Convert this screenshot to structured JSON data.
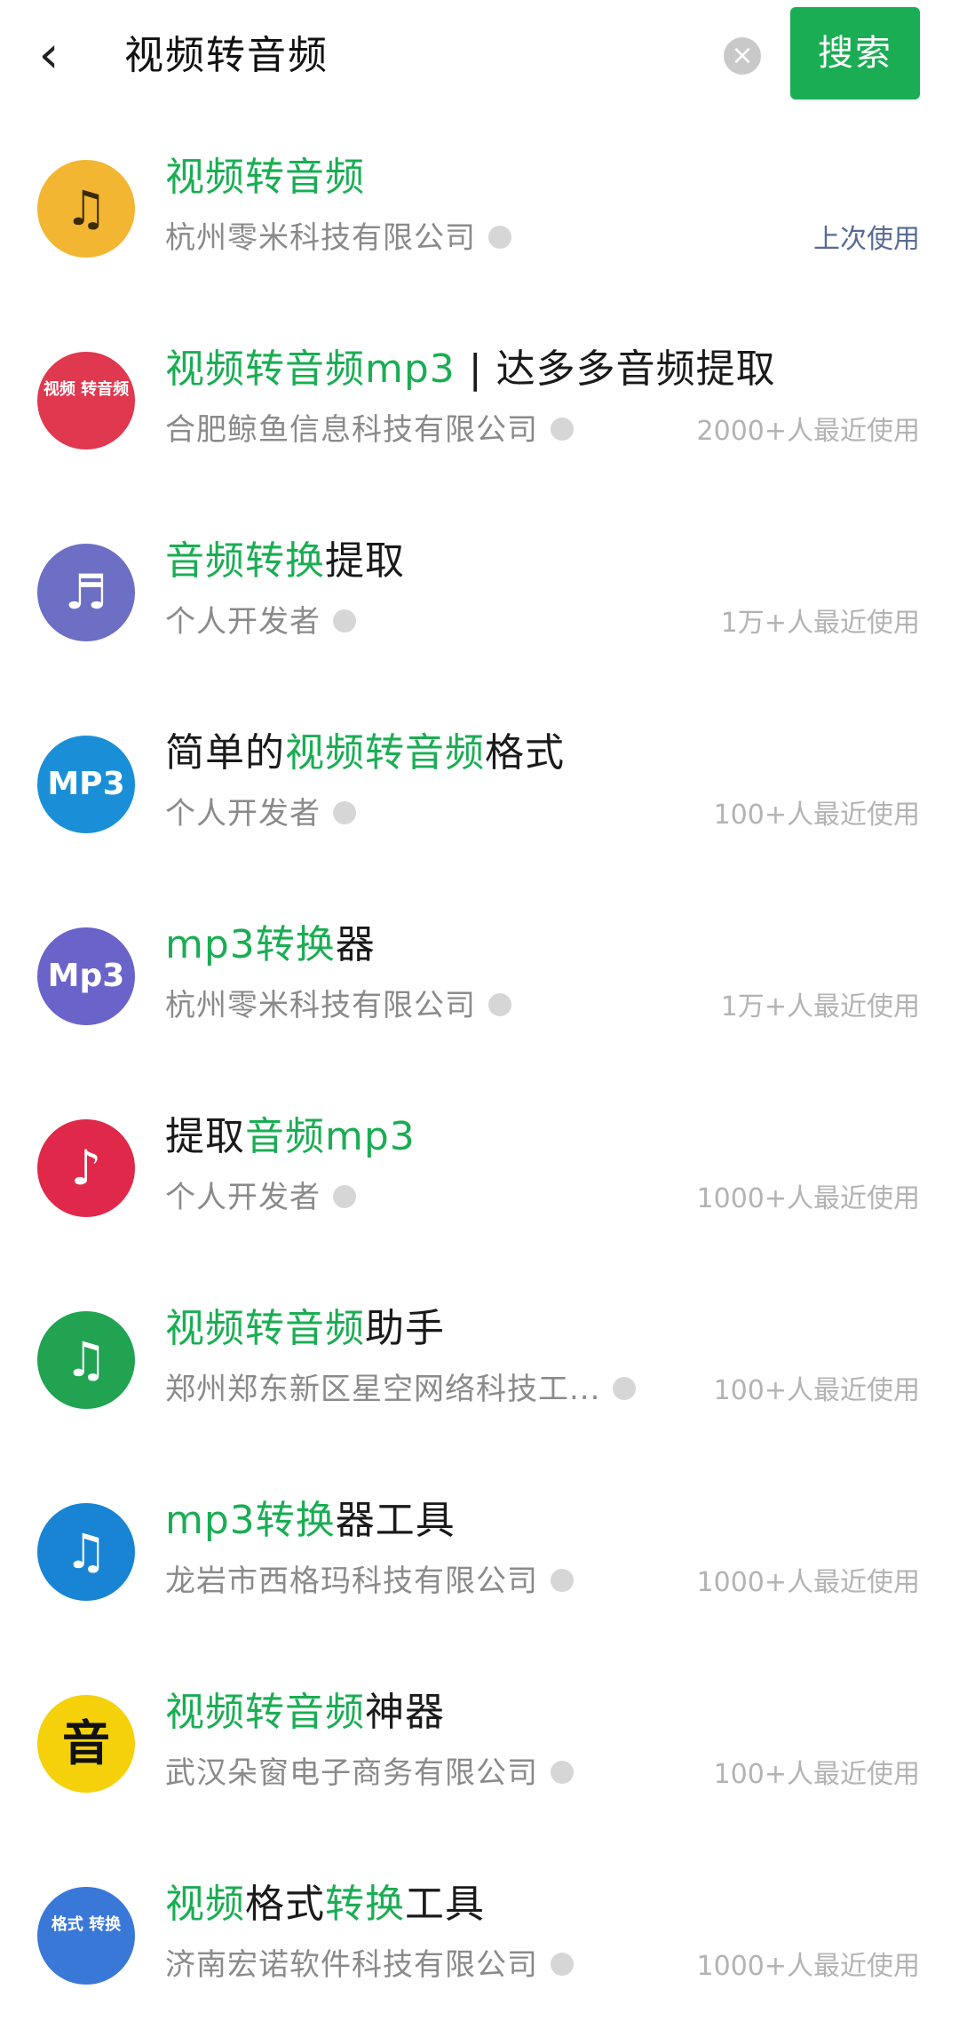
{
  "header": {
    "back_label": "‹",
    "query": "视频转音频",
    "clear_label": "×",
    "search_label": "搜索"
  },
  "colors": {
    "accent": "#1aad53",
    "link": "#576b95"
  },
  "results": [
    {
      "title_parts": [
        {
          "text": "视频转音频",
          "hl": true
        }
      ],
      "company": "杭州零米科技有限公司",
      "meta": "上次使用",
      "icon": {
        "name": "music-note-icon",
        "glyph": "♫",
        "bg": "#f3b632",
        "fg": "#3a2a00"
      }
    },
    {
      "title_parts": [
        {
          "text": "视频转音频",
          "hl": true
        },
        {
          "text": "mp3",
          "hl": true
        },
        {
          "text": " | 达多多音频提取",
          "hl": false
        }
      ],
      "company": "合肥鲸鱼信息科技有限公司",
      "meta": "2000+人最近使用",
      "icon": {
        "name": "app-logo-icon",
        "glyph": "视频 转音频",
        "bg": "#e0384f",
        "fg": "#ffffff"
      }
    },
    {
      "title_parts": [
        {
          "text": "音频转换",
          "hl": true
        },
        {
          "text": "提取",
          "hl": false
        }
      ],
      "company": "个人开发者",
      "meta": "1万+人最近使用",
      "icon": {
        "name": "music-note-icon",
        "glyph": "♬",
        "bg": "#6c6fc4",
        "fg": "#ffffff"
      }
    },
    {
      "title_parts": [
        {
          "text": "简单的",
          "hl": false
        },
        {
          "text": "视频转音频",
          "hl": true
        },
        {
          "text": "格式",
          "hl": false
        }
      ],
      "company": "个人开发者",
      "meta": "100+人最近使用",
      "icon": {
        "name": "mp3-icon",
        "glyph": "MP3",
        "bg": "#1a8fd8",
        "fg": "#ffffff"
      }
    },
    {
      "title_parts": [
        {
          "text": "mp3",
          "hl": true
        },
        {
          "text": "转换",
          "hl": true
        },
        {
          "text": "器",
          "hl": false
        }
      ],
      "company": "杭州零米科技有限公司",
      "meta": "1万+人最近使用",
      "icon": {
        "name": "mp3-icon",
        "glyph": "Mp3",
        "bg": "#6a63c9",
        "fg": "#ffffff"
      }
    },
    {
      "title_parts": [
        {
          "text": "提取",
          "hl": false
        },
        {
          "text": "音频",
          "hl": true
        },
        {
          "text": "mp3",
          "hl": true
        }
      ],
      "company": "个人开发者",
      "meta": "1000+人最近使用",
      "icon": {
        "name": "music-note-icon",
        "glyph": "♪",
        "bg": "#e0284a",
        "fg": "#ffffff"
      }
    },
    {
      "title_parts": [
        {
          "text": "视频转音频",
          "hl": true
        },
        {
          "text": "助手",
          "hl": false
        }
      ],
      "company": "郑州郑东新区星空网络科技工...",
      "meta": "100+人最近使用",
      "icon": {
        "name": "music-note-icon",
        "glyph": "♫",
        "bg": "#21a352",
        "fg": "#ffffff"
      }
    },
    {
      "title_parts": [
        {
          "text": "mp3",
          "hl": true
        },
        {
          "text": "转换",
          "hl": true
        },
        {
          "text": "器工具",
          "hl": false
        }
      ],
      "company": "龙岩市西格玛科技有限公司",
      "meta": "1000+人最近使用",
      "icon": {
        "name": "music-disc-icon",
        "glyph": "♫",
        "bg": "#1a84d4",
        "fg": "#ffffff"
      }
    },
    {
      "title_parts": [
        {
          "text": "视频转音频",
          "hl": true
        },
        {
          "text": "神器",
          "hl": false
        }
      ],
      "company": "武汉朵窗电子商务有限公司",
      "meta": "100+人最近使用",
      "icon": {
        "name": "app-logo-icon",
        "glyph": "音",
        "bg": "#f5d10c",
        "fg": "#111111"
      }
    },
    {
      "title_parts": [
        {
          "text": "视频",
          "hl": true
        },
        {
          "text": "格式",
          "hl": false
        },
        {
          "text": "转换",
          "hl": true
        },
        {
          "text": "工具",
          "hl": false
        }
      ],
      "company": "济南宏诺软件科技有限公司",
      "meta": "1000+人最近使用",
      "icon": {
        "name": "app-logo-icon",
        "glyph": "格式 转换",
        "bg": "#3a78d8",
        "fg": "#ffffff"
      }
    }
  ]
}
